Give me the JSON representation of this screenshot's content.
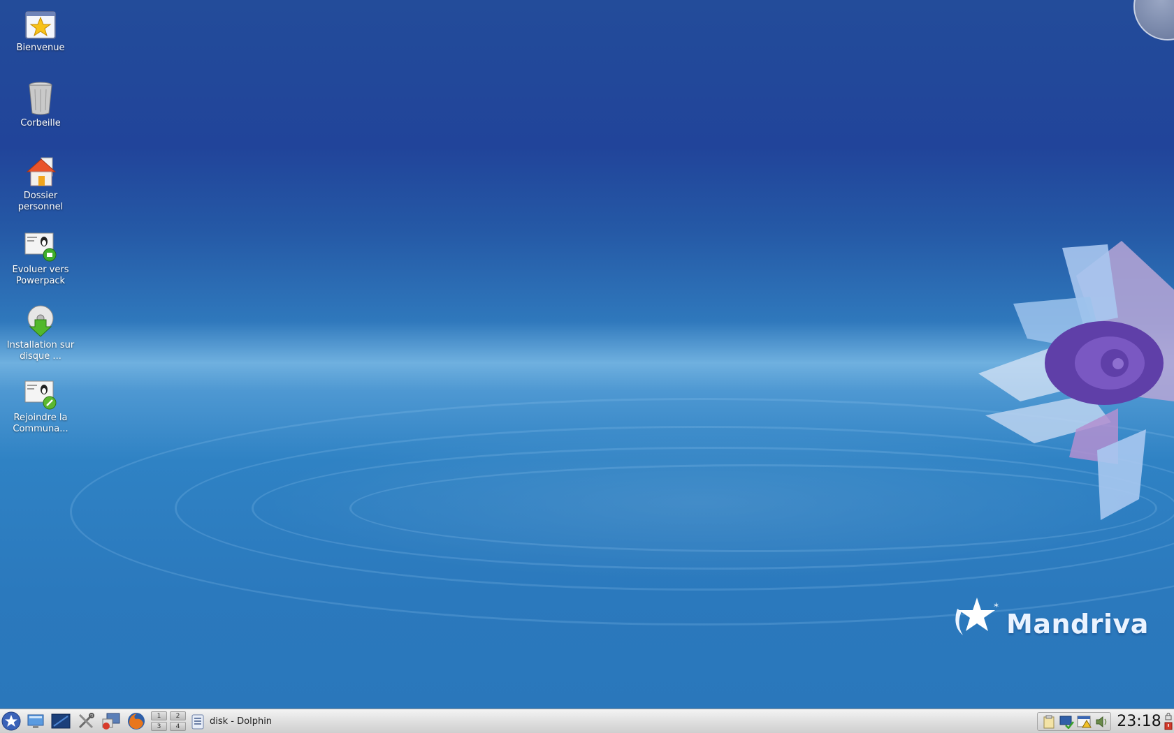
{
  "desktop": {
    "icons": [
      {
        "label": "Bienvenue",
        "icon": "welcome-star-icon"
      },
      {
        "label": "Corbeille",
        "icon": "trash-icon"
      },
      {
        "label": "Dossier personnel",
        "icon": "home-folder-icon"
      },
      {
        "label": "Evoluer vers Powerpack",
        "icon": "upgrade-powerpack-icon"
      },
      {
        "label": "Installation sur disque ...",
        "icon": "install-disk-icon"
      },
      {
        "label": "Rejoindre la Communa...",
        "icon": "join-community-icon"
      }
    ],
    "brand_text": "Mandriva"
  },
  "taskbar": {
    "launchers": [
      "mandriva-menu-icon",
      "show-desktop-icon",
      "terminal-icon",
      "control-center-icon",
      "network-icon",
      "firefox-icon"
    ],
    "pager": [
      "1",
      "2",
      "3",
      "4"
    ],
    "active_task": {
      "label": "disk - Dolphin",
      "icon": "dolphin-icon"
    },
    "tray_icons": [
      "clipboard-icon",
      "network-status-icon",
      "update-icon",
      "volume-icon"
    ],
    "clock": "23:18"
  },
  "colors": {
    "desktop_top": "#21449a",
    "desktop_bottom": "#2a77bb",
    "taskbar": "#dcdcdc"
  }
}
